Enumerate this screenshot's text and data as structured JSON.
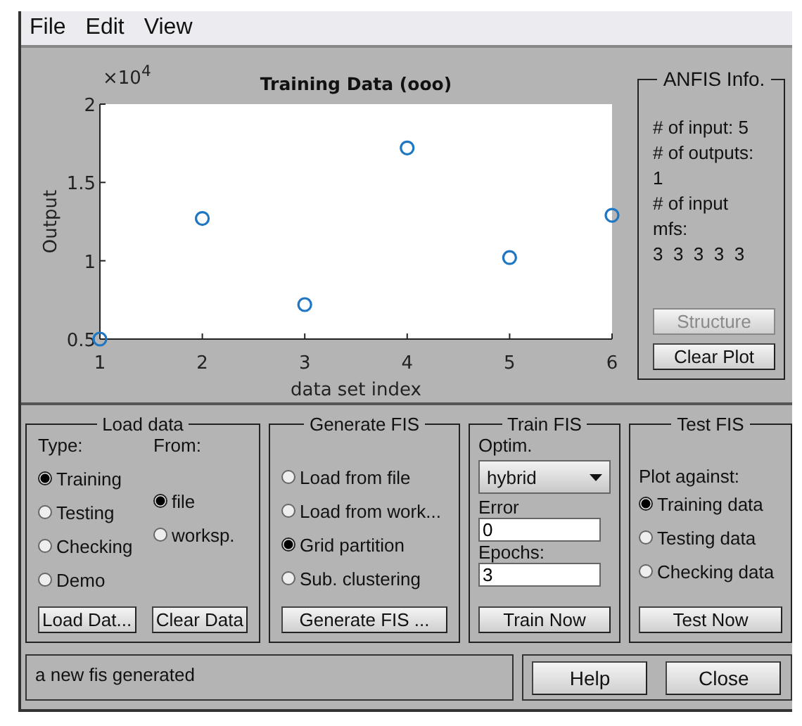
{
  "menu": [
    "File",
    "Edit",
    "View"
  ],
  "plot": {
    "exponent": "×10$^{4}$",
    "chart_data": {
      "type": "scatter",
      "title": "Training Data (ooo)",
      "xlabel": "data set index",
      "ylabel": "Output",
      "x": [
        1,
        2,
        3,
        4,
        5,
        6
      ],
      "series": [
        {
          "color": "#1f77c4",
          "values": [
            0.5,
            1.27,
            0.72,
            1.72,
            1.02,
            1.29
          ]
        }
      ],
      "xlim": [
        1,
        6
      ],
      "ylim": [
        0.5,
        2
      ],
      "xticks": [
        1,
        2,
        3,
        4,
        5,
        6
      ],
      "yticks": [
        {
          "value": 0.5,
          "label": "0.5"
        },
        1,
        {
          "value": 1.5,
          "label": "1.5"
        },
        2
      ]
    }
  },
  "anfis_info": {
    "title": "ANFIS Info.",
    "lines": [
      "# of input: 5",
      "# of outputs:",
      "1",
      "# of input",
      "mfs:",
      "3  3  3  3  3"
    ],
    "buttons": [
      {
        "label": "Structure",
        "disabled": true
      },
      {
        "label": "Clear Plot",
        "disabled": false
      }
    ]
  },
  "load_data": {
    "title": "Load data",
    "type_label": "Type:",
    "from_label": "From:",
    "types": [
      {
        "label": "Training",
        "selected": true
      },
      {
        "label": "Testing",
        "selected": false
      },
      {
        "label": "Checking",
        "selected": false
      },
      {
        "label": "Demo",
        "selected": false
      }
    ],
    "sources": [
      {
        "label": "file",
        "selected": true
      },
      {
        "label": "worksp.",
        "selected": false
      }
    ],
    "buttons": [
      "Load Dat...",
      "Clear Data"
    ]
  },
  "generate_fis": {
    "title": "Generate FIS",
    "options": [
      {
        "label": "Load from file",
        "selected": false
      },
      {
        "label": "Load from work...",
        "selected": false
      },
      {
        "label": "Grid partition",
        "selected": true
      },
      {
        "label": "Sub. clustering",
        "selected": false
      }
    ],
    "button": "Generate FIS ..."
  },
  "train_fis": {
    "title": "Train FIS",
    "optim_label": "Optim.",
    "optim_value": "hybrid",
    "error_label": "Error",
    "error_value": "0",
    "epochs_label": "Epochs:",
    "epochs_value": "3",
    "button": "Train Now"
  },
  "test_fis": {
    "title": "Test FIS",
    "plot_against_label": "Plot against:",
    "options": [
      {
        "label": "Training data",
        "selected": true
      },
      {
        "label": "Testing data",
        "selected": false
      },
      {
        "label": "Checking data",
        "selected": false
      }
    ],
    "button": "Test Now"
  },
  "status": "a new fis generated",
  "buttons": [
    "Help",
    "Close"
  ]
}
